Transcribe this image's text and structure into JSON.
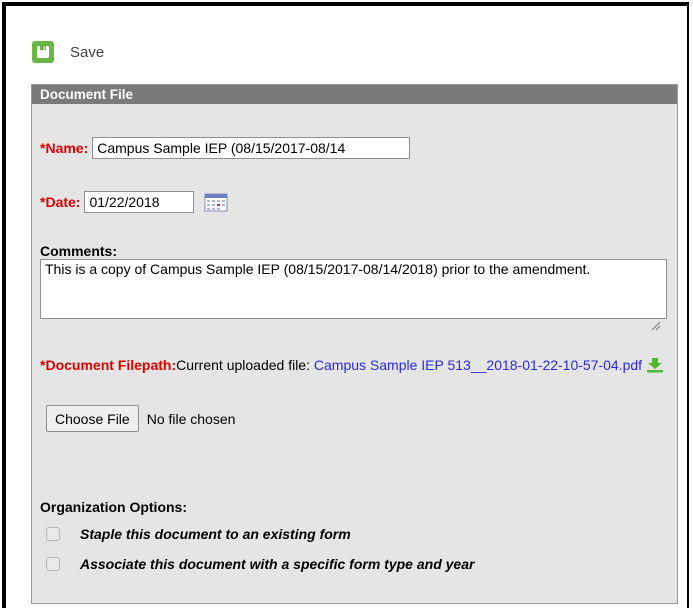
{
  "toolbar": {
    "save_label": "Save",
    "save_icon": "save-icon"
  },
  "panel": {
    "title": "Document File"
  },
  "name_field": {
    "required_mark": "*",
    "label": "Name:",
    "value": "Campus Sample IEP (08/15/2017-08/14"
  },
  "date_field": {
    "required_mark": "*",
    "label": "Date:",
    "value": "01/22/2018",
    "icon": "calendar-icon"
  },
  "comments": {
    "label": "Comments:",
    "value": "This is a copy of Campus Sample IEP (08/15/2017-08/14/2018) prior to the amendment."
  },
  "filepath": {
    "required_mark": "*",
    "label": "Document Filepath:",
    "current_text": "Current uploaded file: ",
    "file_name": "Campus Sample IEP 513__2018-01-22-10-57-04.pdf",
    "icon": "download-icon"
  },
  "file_input": {
    "button_label": "Choose File",
    "status": "No file chosen"
  },
  "organization": {
    "label": "Organization Options:",
    "options": [
      {
        "label": "Staple this document to an existing form",
        "checked": false
      },
      {
        "label": "Associate this document with a specific form type and year",
        "checked": false
      }
    ]
  },
  "colors": {
    "required": "#e00000",
    "link": "#2929e6",
    "save_icon_bg": "#6ab547",
    "header_bg": "#7a7a7a",
    "panel_bg": "#e5e5e5"
  }
}
